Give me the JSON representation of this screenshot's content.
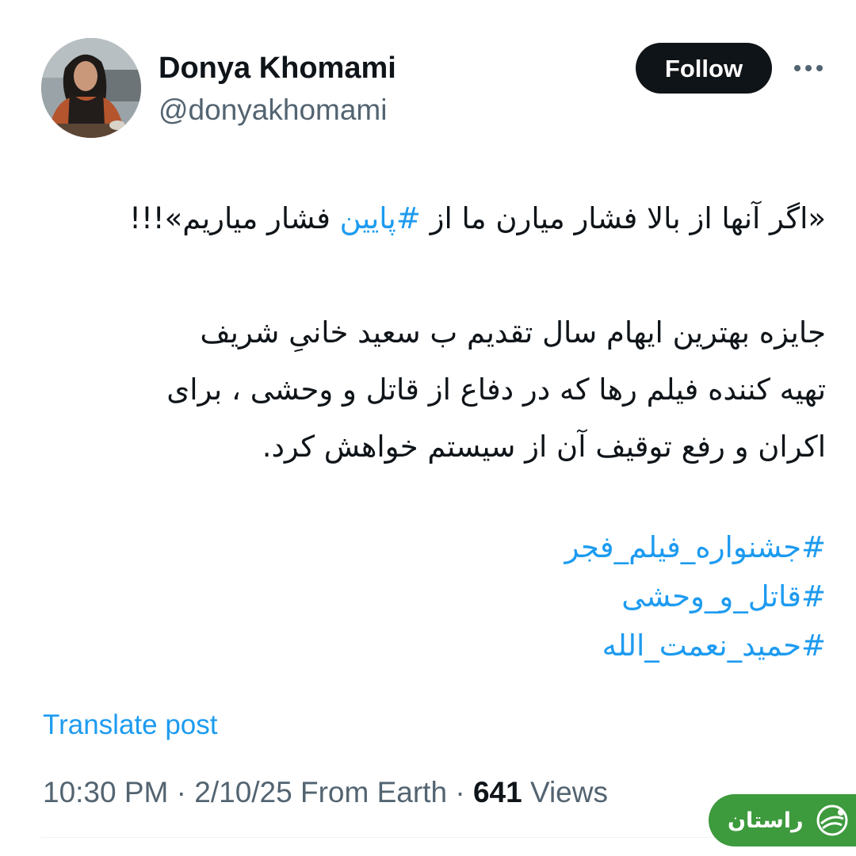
{
  "author": {
    "display_name": "Donya Khomami",
    "handle": "@donyakhomami"
  },
  "follow_label": "Follow",
  "tweet": {
    "line1_prefix": "«اگر آنها از بالا فشار میارن ما از ",
    "line1_hashtag": "#پایین",
    "line1_suffix": " فشار میاریم»!!!",
    "paragraph_lines": [
      "جایزه بهترین ایهام سال تقدیم ب سعید خانیِ شریف",
      "تهیه کننده فیلم رها که در دفاع از قاتل و وحشی ، برای",
      "اکران و رفع توقیف آن از سیستم خواهش کرد."
    ],
    "hashtags": [
      "#جشنواره_فیلم_فجر",
      "#قاتل_و_وحشی",
      "#حمید_نعمت_الله"
    ]
  },
  "translate_label": "Translate post",
  "meta": {
    "time": "10:30 PM",
    "separator": " · ",
    "date": "2/10/25",
    "source": "From Earth",
    "views_count": "641",
    "views_label": "Views"
  },
  "watermark": {
    "text": "راستان",
    "icon": "rastan-logo-icon",
    "color": "#3d9a3d"
  },
  "colors": {
    "link": "#1d9bf0",
    "text": "#0f1419",
    "muted": "#536471",
    "button_bg": "#0f1419"
  }
}
